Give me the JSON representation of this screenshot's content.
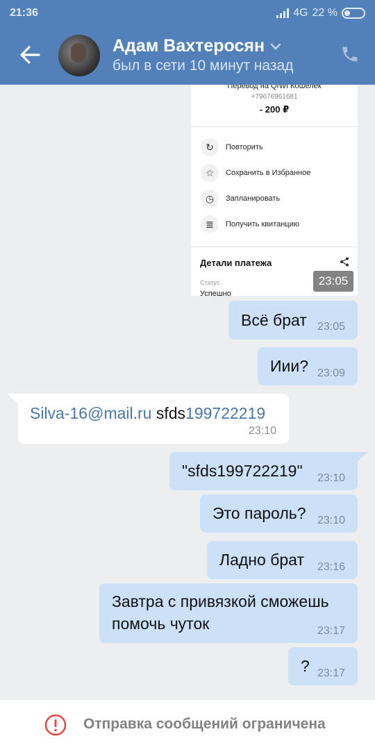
{
  "status_bar": {
    "time": "21:36",
    "network": "4G",
    "battery": "22 %"
  },
  "header": {
    "contact_name": "Адам Вахтеросян",
    "last_seen": "был в сети 10 минут назад"
  },
  "payment": {
    "title": "Перевод на QIWI Кошелек",
    "phone": "+79676961681",
    "amount": "- 200 ₽",
    "actions": [
      {
        "label": "Повторить",
        "icon": "repeat-icon"
      },
      {
        "label": "Сохранить в Избранное",
        "icon": "star-icon"
      },
      {
        "label": "Запланировать",
        "icon": "clock-icon"
      },
      {
        "label": "Получить квитанцию",
        "icon": "receipt-icon"
      }
    ],
    "details_title": "Детали платежа",
    "status_label": "Статус",
    "status_value": "Успешно",
    "time": "23:05"
  },
  "messages": [
    {
      "dir": "out",
      "text": "Всё брат",
      "time": "23:05"
    },
    {
      "dir": "out",
      "text": "Иии?",
      "time": "23:09"
    },
    {
      "dir": "in",
      "link1": "Silva-16@mail.ru",
      "plain": " sfds",
      "link2": "199722219",
      "time": "23:10"
    },
    {
      "dir": "out",
      "text": "\"sfds199722219\"",
      "time": "23:10"
    },
    {
      "dir": "out",
      "text": "Это пароль?",
      "time": "23:10"
    },
    {
      "dir": "out",
      "text": "Ладно брат",
      "time": "23:16"
    },
    {
      "dir": "out",
      "line1": "Завтра с привязкой сможешь",
      "line2": "помочь чуток",
      "time": "23:17"
    },
    {
      "dir": "out",
      "text": "?",
      "time": "23:17"
    }
  ],
  "footer": {
    "text": "Отправка сообщений ограничена"
  },
  "colors": {
    "header": "#5181b8",
    "bubble_out": "#cce0f7",
    "link": "#4a76a8",
    "warning": "#e64646"
  }
}
